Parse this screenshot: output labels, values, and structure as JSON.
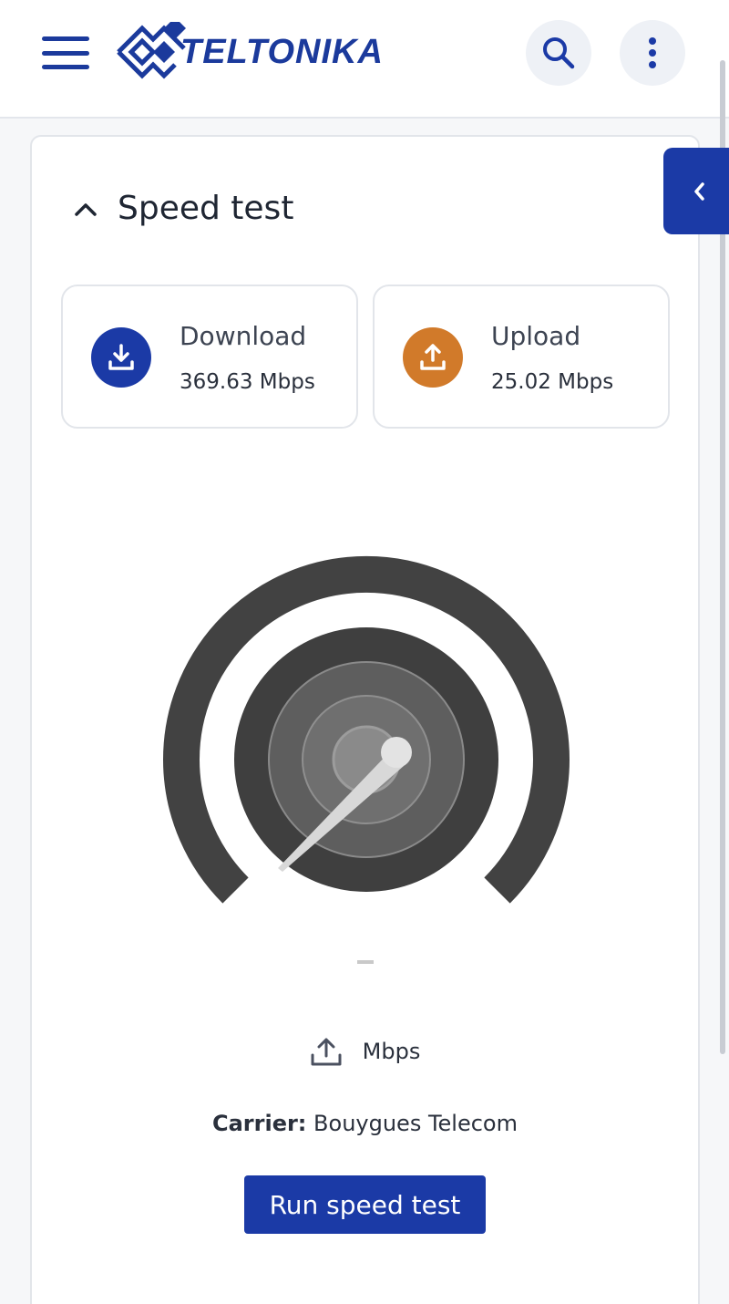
{
  "header": {
    "brand": "TELTONIKA",
    "menu_icon": "hamburger-icon",
    "search_icon": "search-icon",
    "more_icon": "more-vertical-icon"
  },
  "section": {
    "title": "Speed test",
    "collapse_icon": "chevron-up-icon"
  },
  "download": {
    "label": "Download",
    "value": "369.63 Mbps",
    "icon": "download-icon",
    "color": "#1b3aa6"
  },
  "upload": {
    "label": "Upload",
    "value": "25.02 Mbps",
    "icon": "upload-icon",
    "color": "#d17a2a"
  },
  "gauge": {
    "reading": "–",
    "unit": "Mbps",
    "unit_icon": "upload-icon"
  },
  "carrier": {
    "label": "Carrier:",
    "value": "Bouygues Telecom"
  },
  "run_button": "Run speed test",
  "side_tab_icon": "chevron-left-icon",
  "colors": {
    "primary": "#1b3aa6",
    "upload_accent": "#d17a2a",
    "gauge_dark": "#424242"
  }
}
